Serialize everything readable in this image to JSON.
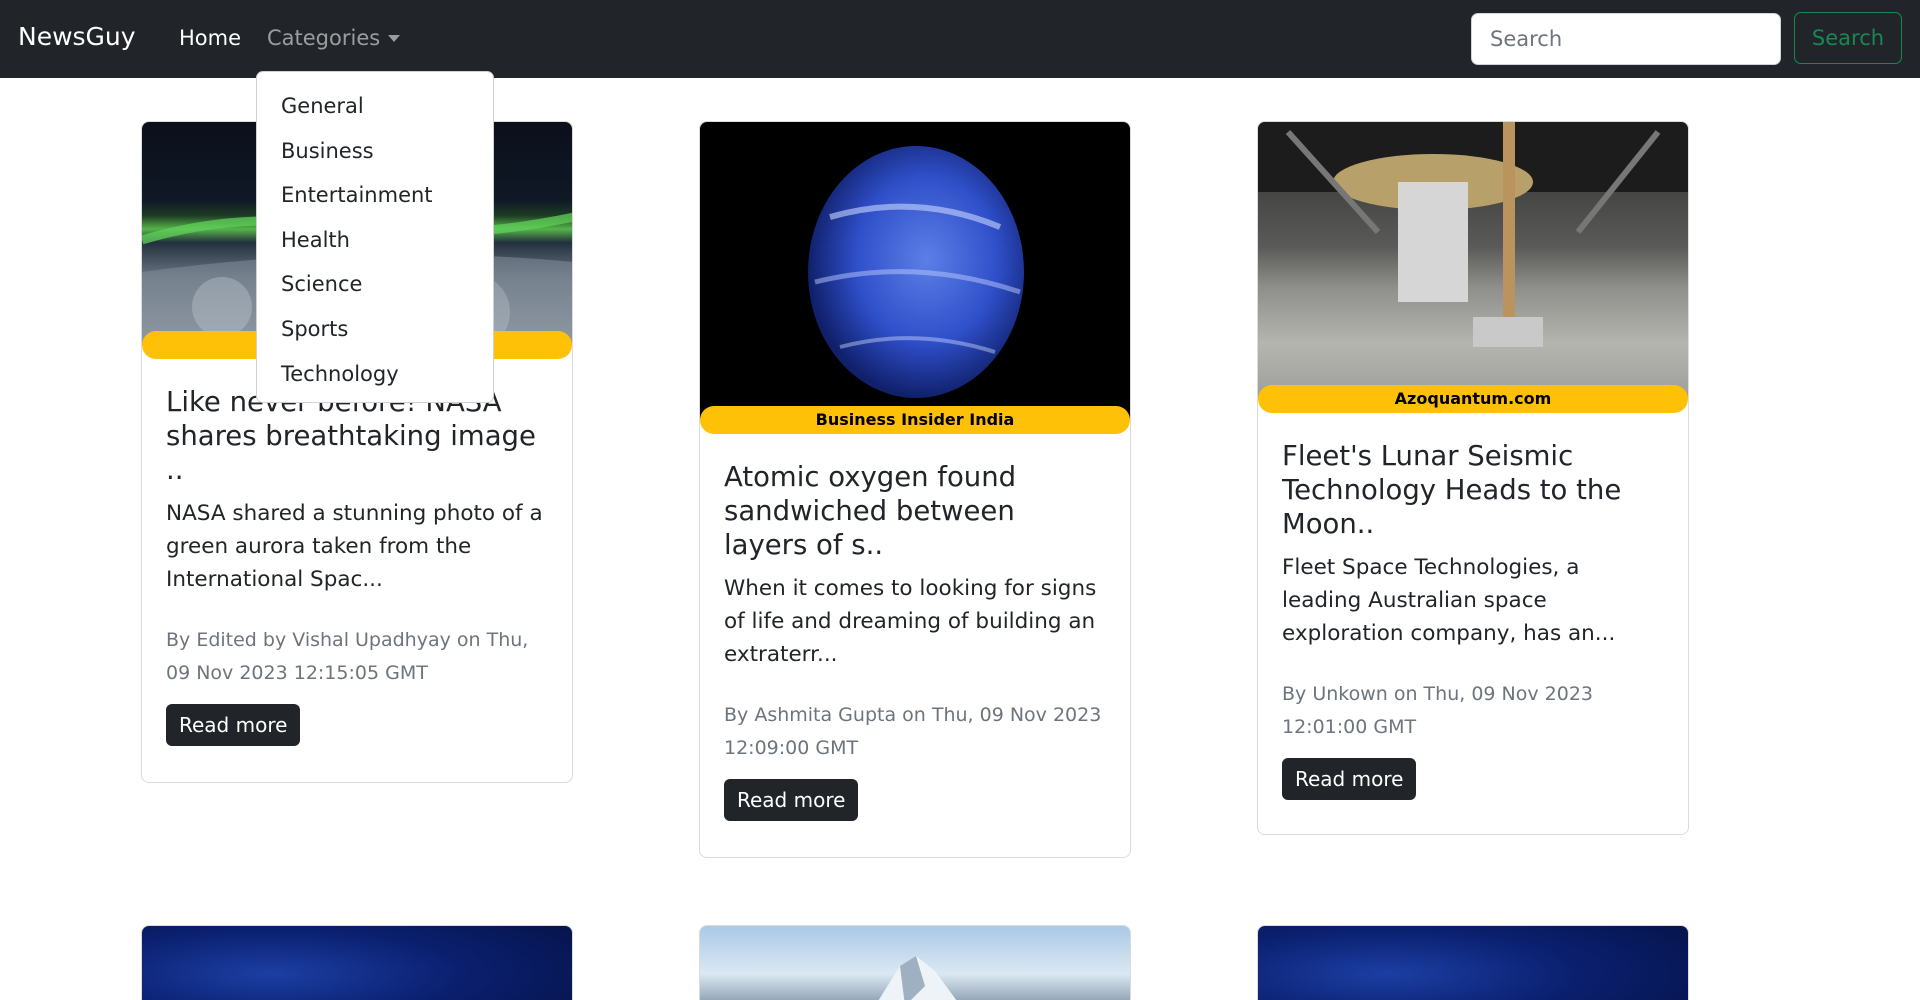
{
  "navbar": {
    "brand": "NewsGuy",
    "home_label": "Home",
    "categories_label": "Categories",
    "search_placeholder": "Search",
    "search_button": "Search"
  },
  "dropdown": {
    "items": [
      "General",
      "Business",
      "Entertainment",
      "Health",
      "Science",
      "Sports",
      "Technology"
    ]
  },
  "cards": [
    {
      "source": "",
      "title": "Like never before! NASA shares breathtaking image ..",
      "description": "NASA shared a stunning photo of a green aurora taken from the International Spac...",
      "meta": "By Edited by Vishal Upadhyay on Thu, 09 Nov 2023 12:15:05 GMT",
      "button": "Read more"
    },
    {
      "source": "Business Insider India",
      "title": "Atomic oxygen found sandwiched between layers of s..",
      "description": "When it comes to looking for signs of life and dreaming of building an extraterr...",
      "meta": "By Ashmita Gupta on Thu, 09 Nov 2023 12:09:00 GMT",
      "button": "Read more"
    },
    {
      "source": "Azoquantum.com",
      "title": "Fleet's Lunar Seismic Technology Heads to the Moon..",
      "description": "Fleet Space Technologies, a leading Australian space exploration company, has an...",
      "meta": "By Unkown on Thu, 09 Nov 2023 12:01:00 GMT",
      "button": "Read more"
    }
  ],
  "colors": {
    "navbar_bg": "#212529",
    "badge": "#ffc107",
    "search_outline": "#198754",
    "button_dark": "#212529"
  }
}
